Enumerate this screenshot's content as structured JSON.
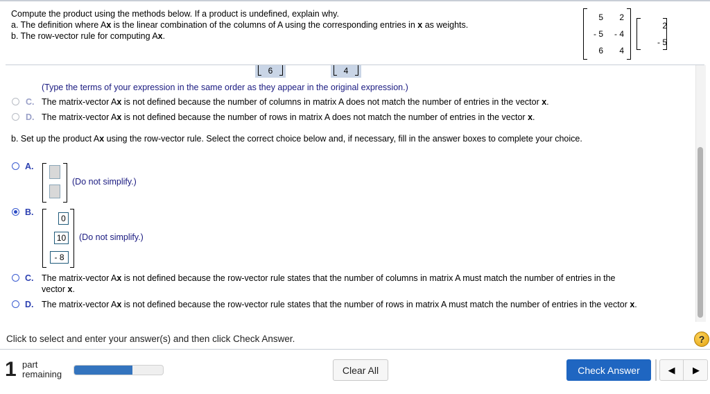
{
  "prompt": {
    "line1": "Compute the product using the methods below. If a product is undefined, explain why.",
    "line2_pre": "a. The definition where A",
    "line2_bold": "x",
    "line2_mid": " is the linear combination of the columns of A using the corresponding entries in ",
    "line2_bold2": "x",
    "line2_post": " as weights.",
    "line3_pre": "b. The row-vector rule for computing A",
    "line3_bold": "x",
    "line3_post": "."
  },
  "matrix_A": [
    [
      "5",
      "2"
    ],
    [
      "- 5",
      "- 4"
    ],
    [
      "6",
      "4"
    ]
  ],
  "vector_x": [
    "2",
    "- 5"
  ],
  "part_a": {
    "partial_vectors": [
      "6",
      "4"
    ],
    "note": "(Type the terms of your expression in the same order as they appear in the original expression.)",
    "options": [
      {
        "letter": "C.",
        "pre": "The matrix-vector A",
        "bold": "x",
        "post": " is not defined because the number of columns in matrix A does not match the number of entries in the vector ",
        "bold2": "x",
        "end": "."
      },
      {
        "letter": "D.",
        "pre": "The matrix-vector A",
        "bold": "x",
        "post": " is not defined because the number of rows in matrix A does not match the number of entries in the vector ",
        "bold2": "x",
        "end": "."
      }
    ]
  },
  "part_b": {
    "question_pre": "b. Set up the product A",
    "question_bold": "x",
    "question_post": " using the row-vector rule. Select the correct choice below and, if necessary, fill in the answer boxes to complete your choice.",
    "option_a": {
      "letter": "A.",
      "note": "(Do not simplify.)",
      "selected": false
    },
    "option_b": {
      "letter": "B.",
      "values": [
        "0",
        "10",
        "- 8"
      ],
      "note": "(Do not simplify.)",
      "selected": true
    },
    "option_c": {
      "letter": "C.",
      "pre": "The matrix-vector A",
      "bold": "x",
      "post": " is not defined because the row-vector rule states that the number of columns in matrix A must match the number of entries in the",
      "line2_pre": "vector ",
      "line2_bold": "x",
      "line2_post": ".",
      "selected": false
    },
    "option_d": {
      "letter": "D.",
      "pre": "The matrix-vector A",
      "bold": "x",
      "post": " is not defined because the row-vector rule states that the number of rows in matrix A must match the number of entries in the vector ",
      "bold2": "x",
      "end": ".",
      "selected": false
    }
  },
  "footer": {
    "instruction": "Click to select and enter your answer(s) and then click Check Answer.",
    "help_icon": "?",
    "parts_remaining_count": "1",
    "parts_remaining_label1": "part",
    "parts_remaining_label2": "remaining",
    "progress_fraction": 0.66,
    "clear_all_label": "Clear All",
    "check_answer_label": "Check Answer",
    "prev_icon": "◀",
    "next_icon": "▶"
  },
  "colors": {
    "accent": "#1f66c1",
    "progress": "#3474be",
    "option_active": "#2b3fb0"
  }
}
